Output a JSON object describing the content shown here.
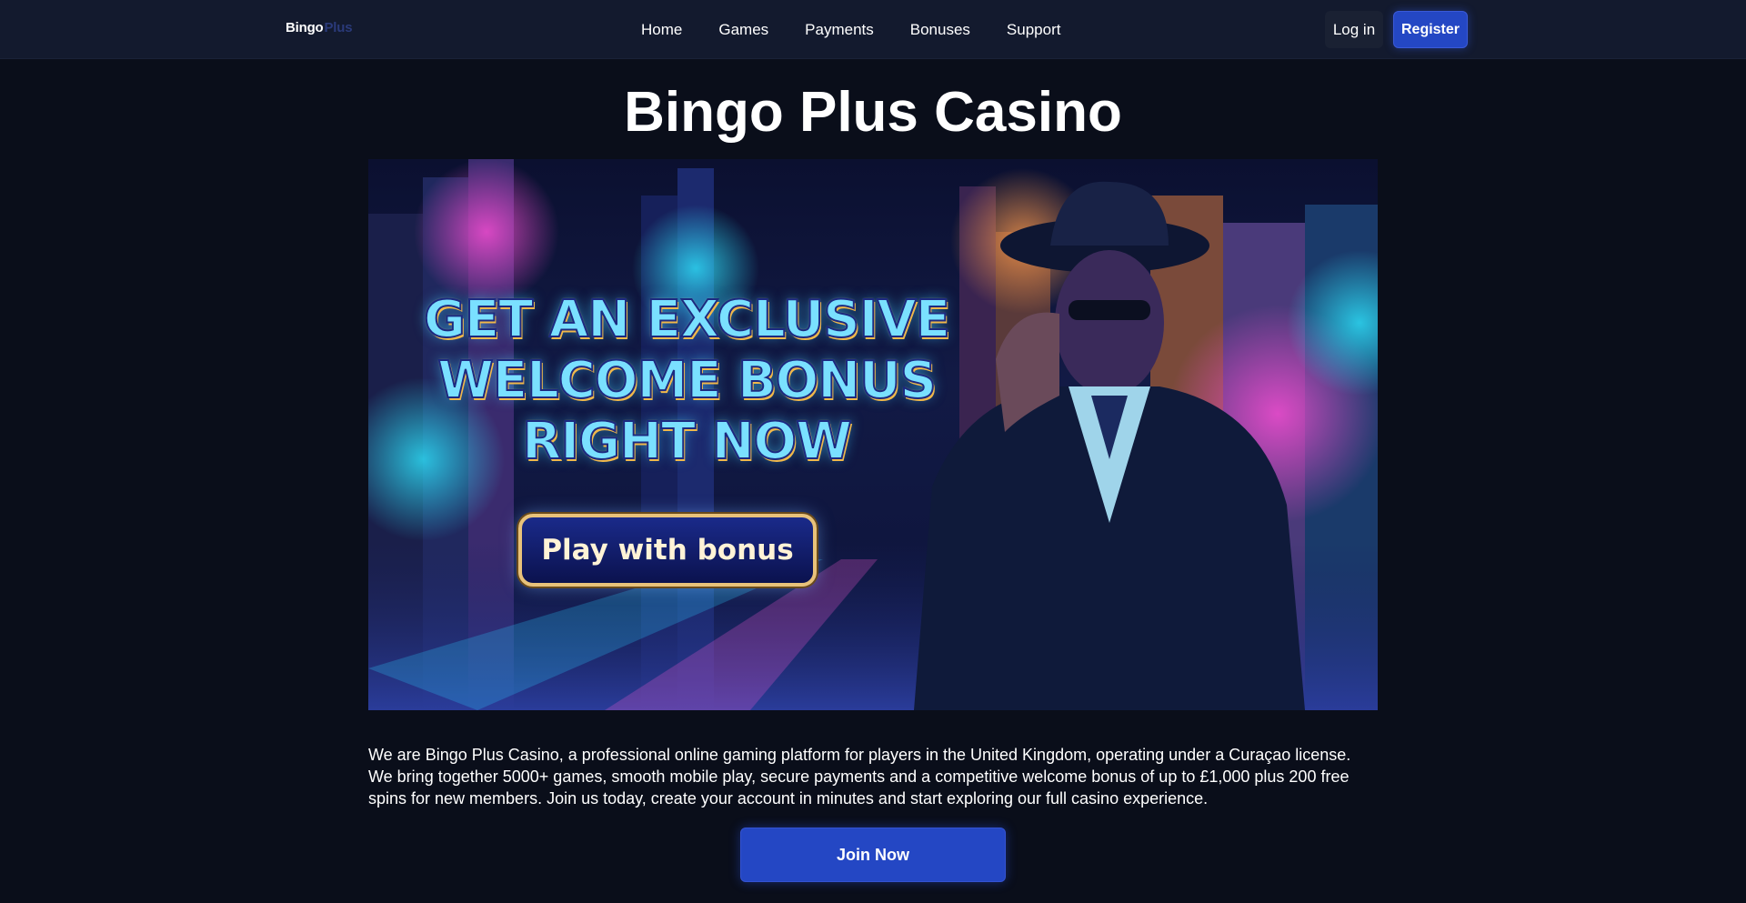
{
  "header": {
    "logo_main": "Bingo",
    "logo_accent": "Plus",
    "nav": [
      "Home",
      "Games",
      "Payments",
      "Bonuses",
      "Support"
    ],
    "login_label": "Log in",
    "register_label": "Register"
  },
  "main": {
    "title": "Bingo Plus Casino",
    "banner": {
      "headline_lines": [
        "GET AN EXCLUSIVE",
        "WELCOME BONUS",
        "RIGHT NOW"
      ],
      "cta_label": "Play with bonus"
    },
    "intro_text": "We are Bingo Plus Casino, a professional online gaming platform for players in the United Kingdom, operating under a Curaçao license. We bring together 5000+ games, smooth mobile play, secure payments and a competitive welcome bonus of up to £1,000 plus 200 free spins for new members. Join us today, create your account in minutes and start exploring our full casino experience.",
    "join_label": "Join Now"
  },
  "colors": {
    "background": "#0a0e1a",
    "header": "#131a2e",
    "accent": "#2447c4"
  }
}
